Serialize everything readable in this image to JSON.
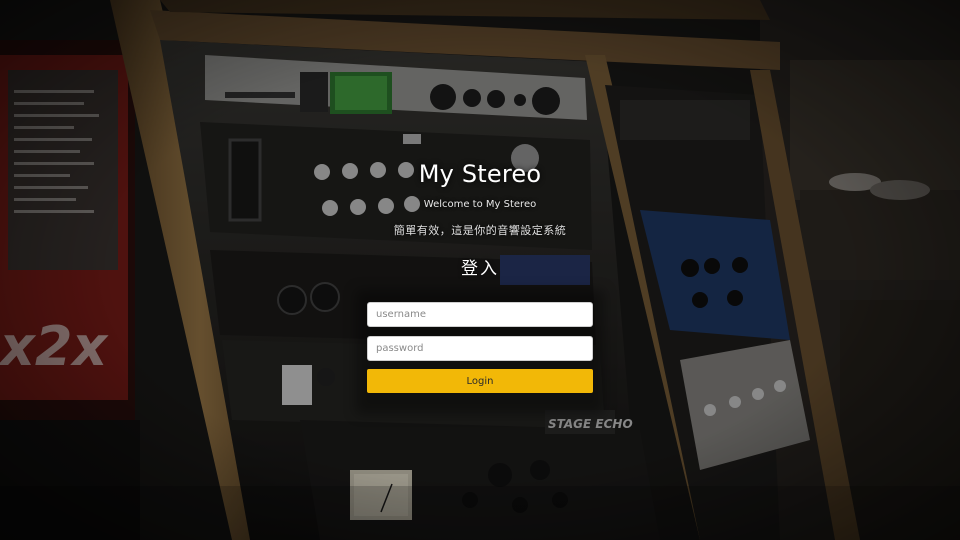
{
  "page": {
    "title": "My Stereo",
    "welcome": "Welcome to My Stereo",
    "tagline": "簡單有效，這是你的音響設定系統",
    "form_heading": "登入"
  },
  "form": {
    "username_placeholder": "username",
    "password_placeholder": "password",
    "login_label": "Login"
  },
  "colors": {
    "accent": "#f2b807",
    "rack_wood": "#8a6a3e",
    "overlay": "#000000"
  },
  "background": {
    "description_icon": "studio-rack-photo"
  }
}
